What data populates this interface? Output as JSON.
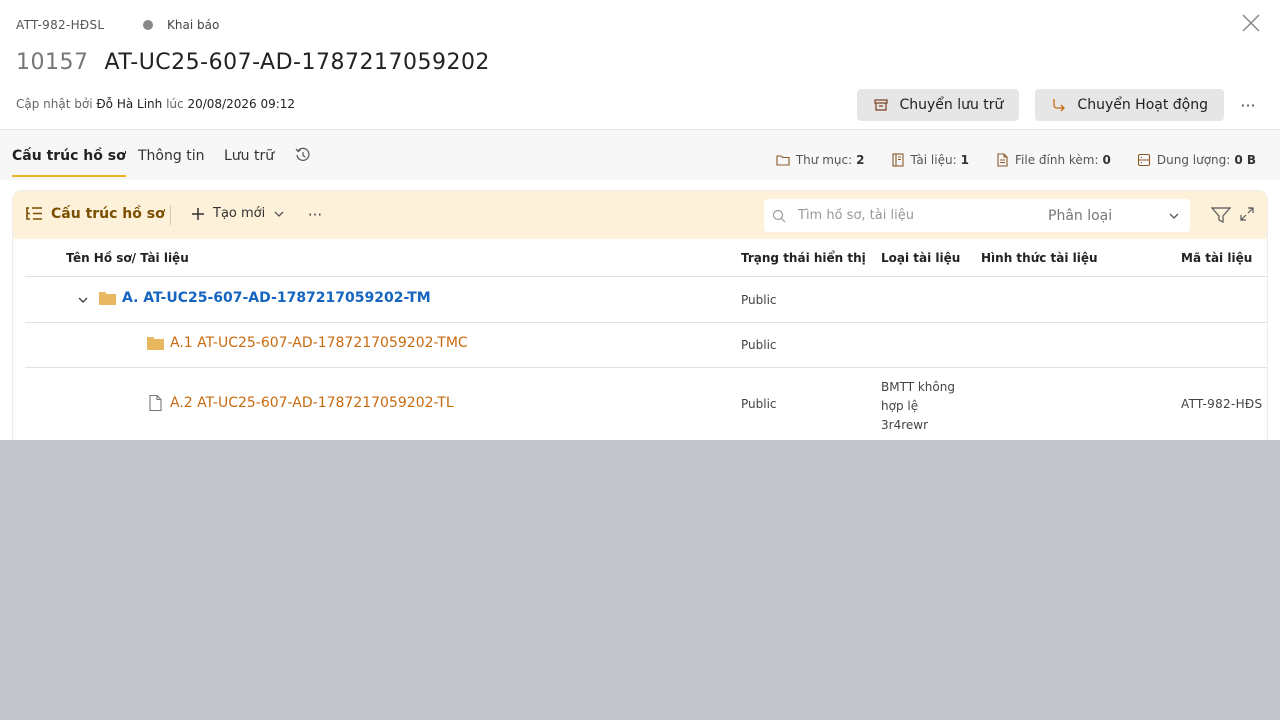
{
  "header": {
    "code": "ATT-982-HĐSL",
    "status": "Khai báo",
    "id": "10157",
    "name": "AT-UC25-607-AD-1787217059202",
    "updated_prefix": "Cập nhật bởi",
    "updated_by": "Đỗ Hà Linh",
    "updated_mid": "lúc",
    "updated_at": "20/08/2026 09:12",
    "btn_archive": "Chuyển lưu trữ",
    "btn_active": "Chuyển Hoạt động",
    "more": "···"
  },
  "tabs": [
    {
      "label": "Cấu trúc hồ sơ",
      "active": true
    },
    {
      "label": "Thông tin",
      "active": false
    },
    {
      "label": "Lưu trữ",
      "active": false
    }
  ],
  "stats": {
    "folders_label": "Thư mục:",
    "folders_value": "2",
    "docs_label": "Tài liệu:",
    "docs_value": "1",
    "files_label": "File đính kèm:",
    "files_value": "0",
    "size_label": "Dung lượng:",
    "size_value": "0 B"
  },
  "toolbar": {
    "title": "Cấu trúc hồ sơ",
    "create": "Tạo mới",
    "more": "···",
    "search_placeholder": "Tìm hồ sơ, tài liệu",
    "category": "Phân loại"
  },
  "table": {
    "columns": [
      "Tên Hồ sơ/ Tài liệu",
      "Trạng thái hiển thị",
      "Loại tài liệu",
      "Hình thức tài liệu",
      "Mã tài liệu"
    ],
    "rows": [
      {
        "name": "A. AT-UC25-607-AD-1787217059202-TM",
        "status": "Public",
        "type": "",
        "form": "",
        "code": ""
      },
      {
        "name": "A.1 AT-UC25-607-AD-1787217059202-TMC",
        "status": "Public",
        "type": "",
        "form": "",
        "code": ""
      },
      {
        "name": "A.2 AT-UC25-607-AD-1787217059202-TL",
        "status": "Public",
        "type": "BMTT không hợp lệ 3r4rewr",
        "type_lines": [
          "BMTT không",
          "hợp lệ",
          "3r4rewr"
        ],
        "form": "",
        "code": "ATT-982-HĐS"
      }
    ]
  },
  "colors": {
    "accent": "#f0b429",
    "toolbar_bg": "#fdf1da",
    "link_blue": "#1565c0",
    "link_orange": "#c86a10",
    "folder": "#e8b860"
  }
}
